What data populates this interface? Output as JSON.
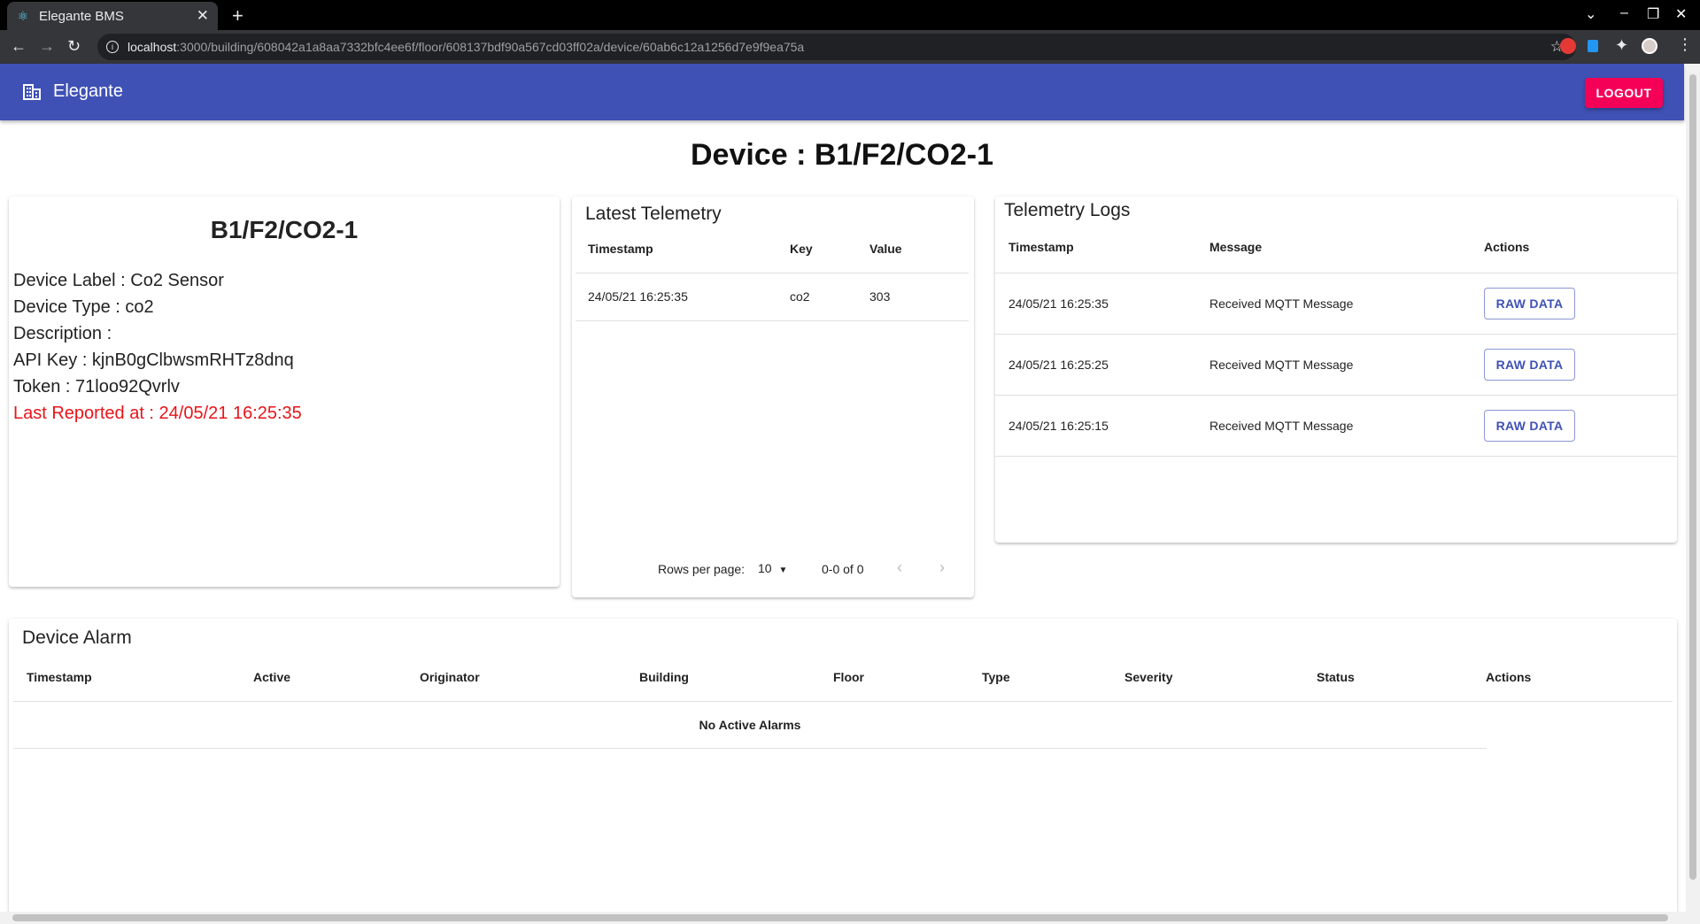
{
  "browser": {
    "tab_title": "Elegante BMS",
    "url_host": "localhost",
    "url_rest": ":3000/building/608042a1a8aa7332bfc4ee6f/floor/608137bdf90a567cd03ff02a/device/60ab6c12a1256d7e9f9ea75a"
  },
  "appbar": {
    "brand": "Elegante",
    "logout": "LOGOUT"
  },
  "page_title": "Device : B1/F2/CO2-1",
  "device": {
    "name": "B1/F2/CO2-1",
    "label": "Device Label : Co2 Sensor",
    "type": "Device Type : co2",
    "description": "Description :",
    "api_key": "API Key : kjnB0gClbwsmRHTz8dnq",
    "token": "Token : 71loo92Qvrlv",
    "last_reported": "Last Reported at : 24/05/21 16:25:35"
  },
  "latest_telemetry": {
    "title": "Latest Telemetry",
    "headers": {
      "timestamp": "Timestamp",
      "key": "Key",
      "value": "Value"
    },
    "rows": [
      {
        "timestamp": "24/05/21 16:25:35",
        "key": "co2",
        "value": "303"
      }
    ],
    "rows_per_page_label": "Rows per page:",
    "rows_per_page": "10",
    "range": "0-0 of 0"
  },
  "telemetry_logs": {
    "title": "Telemetry Logs",
    "headers": {
      "timestamp": "Timestamp",
      "message": "Message",
      "actions": "Actions"
    },
    "rows": [
      {
        "timestamp": "24/05/21 16:25:35",
        "message": "Received MQTT Message",
        "action": "RAW DATA"
      },
      {
        "timestamp": "24/05/21 16:25:25",
        "message": "Received MQTT Message",
        "action": "RAW DATA"
      },
      {
        "timestamp": "24/05/21 16:25:15",
        "message": "Received MQTT Message",
        "action": "RAW DATA"
      }
    ]
  },
  "device_alarm": {
    "title": "Device Alarm",
    "headers": [
      "Timestamp",
      "Active",
      "Originator",
      "Building",
      "Floor",
      "Type",
      "Severity",
      "Status",
      "Actions"
    ],
    "empty": "No Active Alarms"
  },
  "colors": {
    "appbar": "#3f51b5",
    "logout": "#f50057",
    "last_reported": "#e8141a"
  }
}
